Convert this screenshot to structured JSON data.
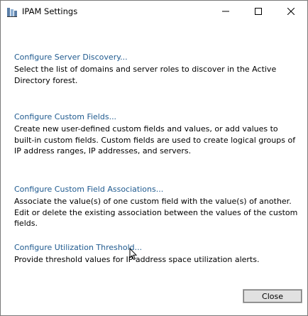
{
  "window": {
    "title": "IPAM Settings"
  },
  "sections": [
    {
      "link": "Configure Server Discovery...",
      "description": "Select the list of domains and server roles to discover in the Active Directory forest."
    },
    {
      "link": "Configure Custom Fields...",
      "description": "Create new user-defined custom fields and values, or add values to built-in custom fields. Custom fields are used to create logical groups of IP address ranges, IP addresses, and servers."
    },
    {
      "link": "Configure Custom Field Associations...",
      "description": "Associate the value(s) of one custom field with the value(s) of another. Edit or delete the existing association between the values of the custom fields."
    },
    {
      "link": "Configure Utilization Threshold...",
      "description": "Provide threshold values for IP address space utilization alerts."
    }
  ],
  "buttons": {
    "close": "Close"
  },
  "colors": {
    "link": "#1f5a8f"
  }
}
